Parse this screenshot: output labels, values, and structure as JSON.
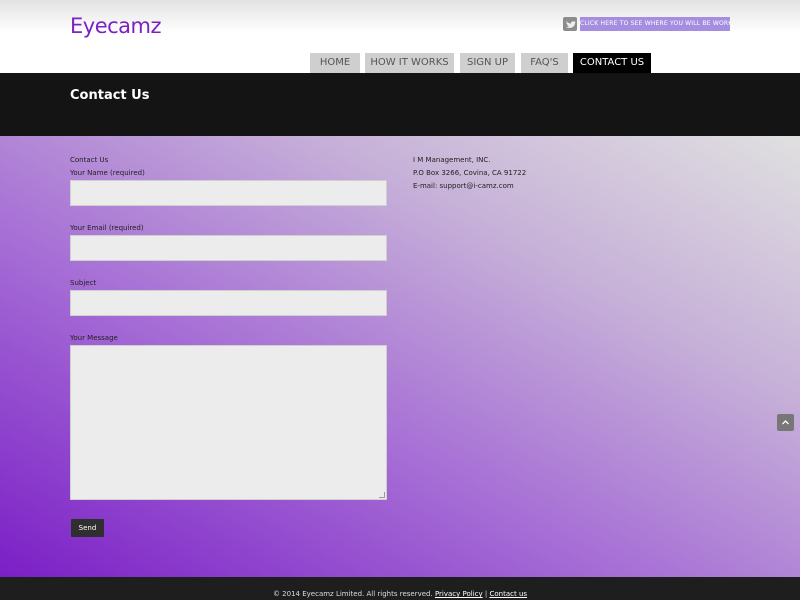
{
  "header": {
    "logo": "Eyecamz",
    "cta": "CLICK HERE TO SEE WHERE YOU WILL BE WORKING",
    "twitter_icon": "twitter-icon"
  },
  "nav": {
    "items": [
      {
        "label": "HOME"
      },
      {
        "label": "HOW IT WORKS"
      },
      {
        "label": "SIGN UP"
      },
      {
        "label": "FAQ'S"
      },
      {
        "label": "CONTACT US"
      }
    ],
    "active": "CONTACT US"
  },
  "title": "Contact Us",
  "form": {
    "heading": "Contact Us",
    "name_label": "Your Name (required)",
    "email_label": "Your Email (required)",
    "subject_label": "Subject",
    "message_label": "Your Message",
    "send_label": "Send"
  },
  "address": {
    "line1": "I M Management, INC.",
    "line2": "P.O Box 3266, Covina, CA 91722",
    "line3": "E-mail: support@i-camz.com"
  },
  "footer": {
    "copyright": "© 2014 Eyecamz Limited. All rights reserved.",
    "privacy": "Privacy Policy",
    "separator": "|",
    "contact": "Contact us"
  },
  "colors": {
    "brand": "#7b22c2",
    "cta": "#a58ee0",
    "active_nav": "#000000"
  }
}
